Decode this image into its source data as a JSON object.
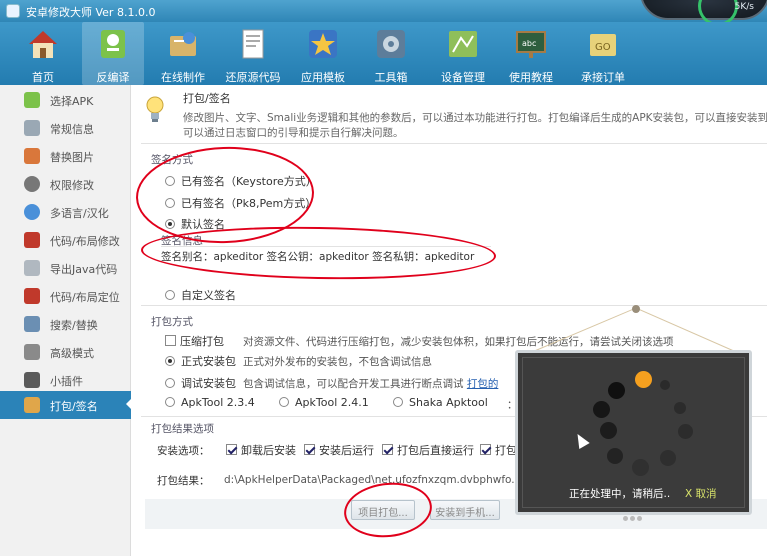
{
  "window": {
    "title": "安卓修改大师 Ver 8.1.0.0",
    "speed": "5K/s"
  },
  "toolbar": {
    "items": [
      {
        "label": "首页",
        "icon": "home-icon"
      },
      {
        "label": "反编译",
        "icon": "decompile-icon",
        "active": true
      },
      {
        "label": "在线制作",
        "icon": "online-make-icon"
      },
      {
        "label": "还原源代码",
        "icon": "restore-source-icon"
      },
      {
        "label": "应用模板",
        "icon": "app-template-icon"
      },
      {
        "label": "工具箱",
        "icon": "toolbox-icon"
      },
      {
        "label": "设备管理",
        "icon": "device-manage-icon"
      },
      {
        "label": "使用教程",
        "icon": "tutorial-icon"
      },
      {
        "label": "承接订单",
        "icon": "orders-icon"
      }
    ]
  },
  "sidebar": {
    "items": [
      {
        "label": "选择APK"
      },
      {
        "label": "常规信息"
      },
      {
        "label": "替换图片"
      },
      {
        "label": "权限修改"
      },
      {
        "label": "多语言/汉化"
      },
      {
        "label": "代码/布局修改"
      },
      {
        "label": "导出Java代码"
      },
      {
        "label": "代码/布局定位"
      },
      {
        "label": "搜索/替换"
      },
      {
        "label": "高级模式"
      },
      {
        "label": "小插件"
      },
      {
        "label": "打包/签名",
        "active": true
      }
    ]
  },
  "header": {
    "title": "打包/签名",
    "desc_line1": "修改图片、文字、Smali业务逻辑和其他的参数后，可以通过本功能进行打包。打包编译后生成的APK安装包，可以直接安装到手",
    "desc_line2": "可以通过日志窗口的引导和提示自行解决问题。"
  },
  "signing": {
    "section_label": "签名方式",
    "options": [
      {
        "label": "已有签名（Keystore方式）",
        "selected": false
      },
      {
        "label": "已有签名（Pk8,Pem方式）",
        "selected": false
      },
      {
        "label": "默认签名",
        "selected": true
      }
    ],
    "info_label": "签名信息",
    "info_text": "签名别名：apkeditor   签名公钥：apkeditor   签名私钥：apkeditor",
    "custom_label": "自定义签名"
  },
  "packing": {
    "section_label": "打包方式",
    "compress_label": "压缩打包",
    "compress_checked": false,
    "compress_desc": "对资源文件、代码进行压缩打包，减少安装包体积，如果打包后不能运行，请尝试关闭该选项",
    "official_label": "正式安装包",
    "official_selected": true,
    "official_desc": "正式对外发布的安装包，不包含调试信息",
    "debug_label": "调试安装包",
    "debug_selected": false,
    "debug_desc": "包含调试信息，可以配合开发工具进行断点调试",
    "debug_link": "打包的",
    "tools": [
      {
        "label": "ApkTool 2.3.4",
        "selected": false
      },
      {
        "label": "ApkTool 2.4.1",
        "selected": false
      },
      {
        "label": "Shaka Apktool",
        "selected": false
      }
    ],
    "tools_tail": "：如"
  },
  "result": {
    "section_label": "打包结果选项",
    "install_label": "安装选项：",
    "install_options": [
      {
        "label": "卸载后安装",
        "checked": true
      },
      {
        "label": "安装后运行",
        "checked": true
      },
      {
        "label": "打包后直接运行",
        "checked": true
      },
      {
        "label": "打包",
        "checked": true
      }
    ],
    "result_label": "打包结果：",
    "result_path": "d:\\ApkHelperData\\Packaged\\net.ufozfnxzqm.dvbphwfo.apk",
    "btn_pack": "项目打包...",
    "btn_install": "安装到手机..."
  },
  "dialog": {
    "processing": "正在处理中，请稍后..",
    "cancel": "X 取消",
    "accent": "#f5a01f"
  },
  "colors": {
    "toolbar": "#2f86b6",
    "sidebar_active": "#2b83b8",
    "annotation": "#e0001b"
  }
}
